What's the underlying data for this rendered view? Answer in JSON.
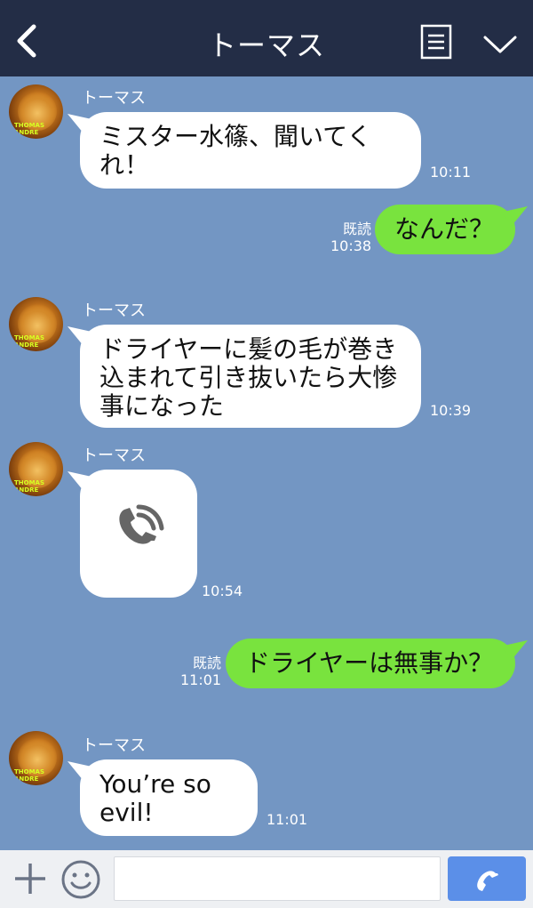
{
  "header": {
    "title": "トーマス",
    "back_icon": "chevron-left-icon",
    "menu_icon": "notes-icon",
    "dropdown_icon": "chevron-down-icon",
    "bg_color": "#232d46"
  },
  "messages": [
    {
      "direction": "in",
      "sender": "トーマス",
      "text": "ミスター水篠、聞いてくれ！",
      "time": "10:11"
    },
    {
      "direction": "out",
      "read": "既読",
      "text": "なんだ？",
      "time": "10:38"
    },
    {
      "direction": "in",
      "sender": "トーマス",
      "text": "ドライヤーに髪の毛が巻き込まれて引き抜いたら大惨事になった",
      "time": "10:39"
    },
    {
      "direction": "in",
      "sender": "トーマス",
      "type": "call",
      "icon": "phone-missed-icon",
      "time": "10:54"
    },
    {
      "direction": "out",
      "read": "既読",
      "text": "ドライヤーは無事か？",
      "time": "11:01"
    },
    {
      "direction": "in",
      "sender": "トーマス",
      "text": "You’re so evil!",
      "time": "11:01"
    }
  ],
  "input": {
    "placeholder": "",
    "plus_icon": "plus-icon",
    "emoji_icon": "smiley-icon",
    "call_icon": "phone-icon"
  },
  "colors": {
    "chat_bg": "#7396c3",
    "incoming": "#ffffff",
    "outgoing": "#79e33e",
    "call_button": "#5b8fe8"
  }
}
